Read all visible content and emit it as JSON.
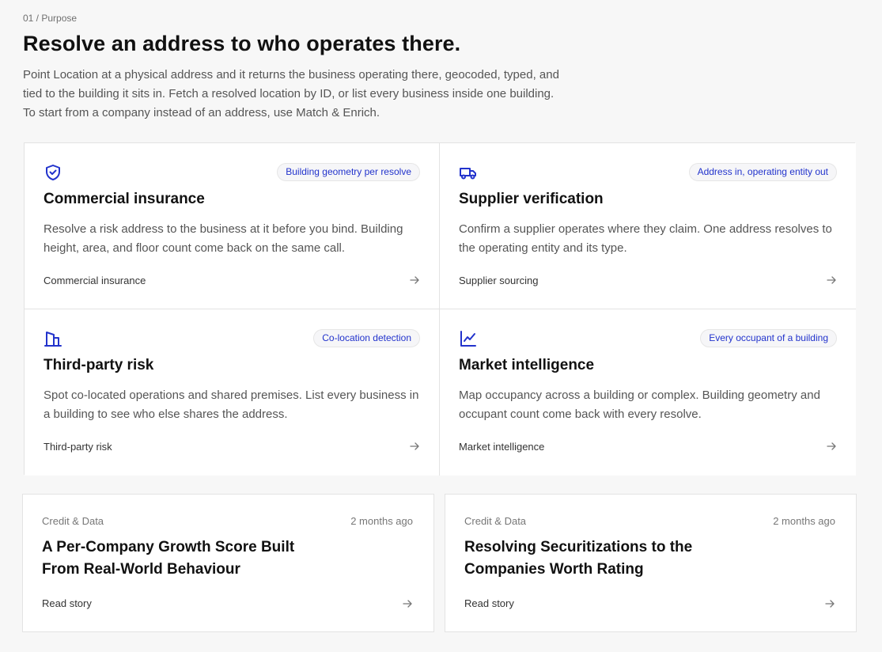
{
  "header": {
    "eyebrow": "01 / Purpose",
    "title": "Resolve an address to who operates there.",
    "lede": "Point Location at a physical address and it returns the business operating there, geocoded, typed, and tied to the building it sits in. Fetch a resolved location by ID, or list every business inside one building. To start from a company instead of an address, use Match & Enrich."
  },
  "accent_color": "#2233cc",
  "cards": [
    {
      "icon": "shield-check-icon",
      "badge": "Building geometry per resolve",
      "title": "Commercial insurance",
      "description": "Resolve a risk address to the business at it before you bind. Building height, area, and floor count come back on the same call.",
      "link": "Commercial insurance"
    },
    {
      "icon": "truck-icon",
      "badge": "Address in, operating entity out",
      "title": "Supplier verification",
      "description": "Confirm a supplier operates where they claim. One address resolves to the operating entity and its type.",
      "link": "Supplier sourcing"
    },
    {
      "icon": "building-icon",
      "badge": "Co-location detection",
      "title": "Third-party risk",
      "description": "Spot co-located operations and shared premises. List every business in a building to see who else shares the address.",
      "link": "Third-party risk"
    },
    {
      "icon": "line-chart-icon",
      "badge": "Every occupant of a building",
      "title": "Market intelligence",
      "description": "Map occupancy across a building or complex. Building geometry and occupant count come back with every resolve.",
      "link": "Market intelligence"
    }
  ],
  "stories": [
    {
      "category": "Credit & Data",
      "time": "2 months ago",
      "title": "A Per-Company Growth Score Built From Real-World Behaviour",
      "link": "Read story"
    },
    {
      "category": "Credit & Data",
      "time": "2 months ago",
      "title": "Resolving Securitizations to the Companies Worth Rating",
      "link": "Read story"
    }
  ]
}
